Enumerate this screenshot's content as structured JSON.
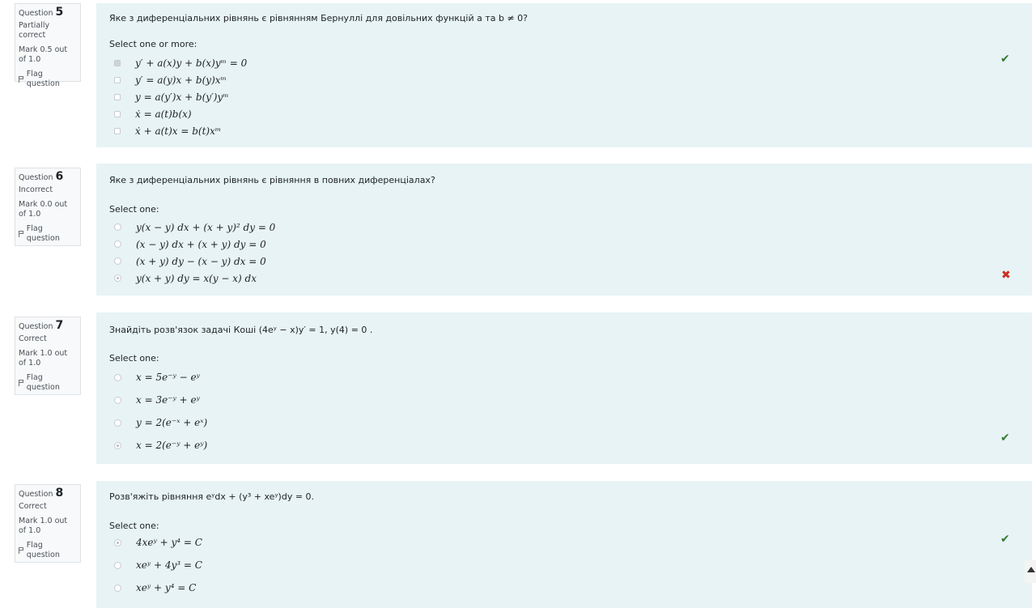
{
  "questions": [
    {
      "label": "Question",
      "number": "5",
      "state": "Partially correct",
      "mark": "Mark 0.5 out of 1.0",
      "flag": "Flag question",
      "text": "Яке з диференціальних рівнянь є рівнянням Бернуллі  для довільних функцій a та b ≠ 0?",
      "prompt": "Select one or more:",
      "input": "checkbox",
      "answers": [
        {
          "text": "y′ + a(x)y + b(x)yᵐ = 0",
          "checked": true
        },
        {
          "text": "y′ = a(y)x + b(y)xᵐ",
          "checked": false
        },
        {
          "text": "y = a(y′)x + b(y′)yᵐ",
          "checked": false
        },
        {
          "text": "ẋ = a(t)b(x)",
          "checked": false
        },
        {
          "text": "ẋ + a(t)x = b(t)xᵐ",
          "checked": false
        }
      ],
      "result_icon": "check-icon",
      "result_color": "#357a32"
    },
    {
      "label": "Question",
      "number": "6",
      "state": "Incorrect",
      "mark": "Mark 0.0 out of 1.0",
      "flag": "Flag question",
      "text": "Яке з диференціальних рівнянь є рівняння в повних диференціалах?",
      "prompt": "Select one:",
      "input": "radio",
      "answers": [
        {
          "text": "y(x − y) dx + (x + y)² dy = 0",
          "checked": false
        },
        {
          "text": "(x − y) dx + (x + y) dy = 0",
          "checked": false
        },
        {
          "text": "(x + y) dy − (x − y) dx = 0",
          "checked": false
        },
        {
          "text": "y(x + y) dy = x(y − x) dx",
          "checked": true
        }
      ],
      "result_icon": "cross-icon",
      "result_color": "#ca3120"
    },
    {
      "label": "Question",
      "number": "7",
      "state": "Correct",
      "mark": "Mark 1.0 out of 1.0",
      "flag": "Flag question",
      "text": "Знайдіть розв'язок задачі Коші (4eʸ − x)y′ = 1,  y(4) = 0 .",
      "prompt": "Select one:",
      "input": "radio",
      "answers": [
        {
          "text": "x = 5e⁻ʸ − eʸ",
          "checked": false
        },
        {
          "text": "x = 3e⁻ʸ + eʸ",
          "checked": false
        },
        {
          "text": "y = 2(e⁻ˣ + eˣ)",
          "checked": false
        },
        {
          "text": "x = 2(e⁻ʸ + eʸ)",
          "checked": true
        }
      ],
      "result_icon": "check-icon",
      "result_color": "#357a32"
    },
    {
      "label": "Question",
      "number": "8",
      "state": "Correct",
      "mark": "Mark 1.0 out of 1.0",
      "flag": "Flag question",
      "text": "Розв'яжіть рівняння  eʸdx + (y³ + xeʸ)dy = 0.",
      "prompt": "Select one:",
      "input": "radio",
      "answers": [
        {
          "text": "4xeʸ + y⁴ = C",
          "checked": true
        },
        {
          "text": "xeʸ + 4y³ = C",
          "checked": false
        },
        {
          "text": "xeʸ + y⁴ = C",
          "checked": false
        }
      ],
      "result_icon": "check-icon",
      "result_color": "#357a32"
    }
  ]
}
